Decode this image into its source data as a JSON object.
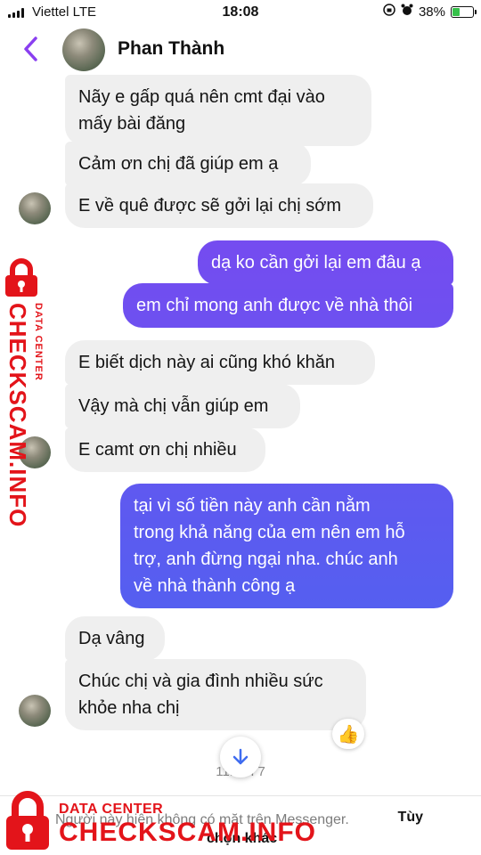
{
  "status_bar": {
    "carrier": "Viettel  LTE",
    "time": "18:08",
    "battery": "38%",
    "battery_level": 0.38
  },
  "header": {
    "contact_name": "Phan Thành"
  },
  "messages": [
    {
      "dir": "in",
      "text": "Nãy e gấp quá nên cmt đại vào\nmấy bài đăng"
    },
    {
      "dir": "in",
      "text": "Cảm ơn chị đã giúp em ạ"
    },
    {
      "dir": "in",
      "text": "E về quê được sẽ gởi lại chị sớm"
    },
    {
      "dir": "out",
      "text": "dạ ko cần gởi lại em đâu ạ"
    },
    {
      "dir": "out",
      "text": "em chỉ mong anh được về nhà thôi"
    },
    {
      "dir": "in",
      "text": "E biết dịch này ai cũng khó khăn"
    },
    {
      "dir": "in",
      "text": "Vậy mà chị vẫn giúp em"
    },
    {
      "dir": "in",
      "text": "E camt ơn chị nhiều"
    },
    {
      "dir": "out",
      "text": "tại vì số tiền này anh cần nằm\ntrong khả năng của em nên em hỗ\ntrợ, anh đừng ngại nha. chúc anh\nvề nhà thành công ạ"
    },
    {
      "dir": "in",
      "text": "Dạ vâng"
    },
    {
      "dir": "in",
      "text": "Chúc chị và gia đình nhiều sức\nkhỏe nha chị"
    }
  ],
  "reaction": "👍",
  "timestamp": "11:2   H 7",
  "footer": {
    "note": "Người này hiện không có mặt trên Messenger.",
    "action_1": "Tùy",
    "action_2": "chọn khác"
  },
  "watermark": {
    "brand": "CHECKSCAM.INFO",
    "tag": "DATA CENTER"
  },
  "colors": {
    "accent": "#8a3ff0",
    "bubble_in": "#efefef",
    "bubble_out_top": "#8a3ff0",
    "bubble_out_bottom": "#3f6cf0",
    "watermark": "#e3141a"
  }
}
